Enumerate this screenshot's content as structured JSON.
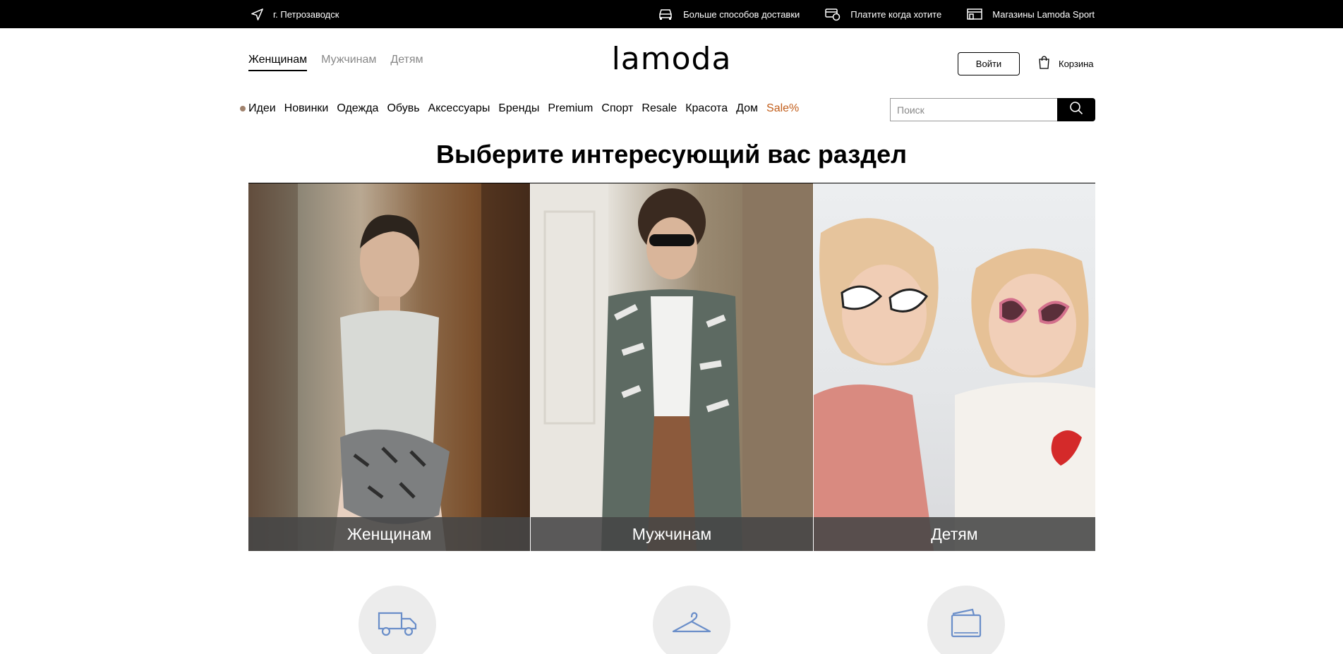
{
  "topbar": {
    "city": "г. Петрозаводск",
    "links": [
      {
        "icon": "car-icon",
        "label": "Больше способов доставки"
      },
      {
        "icon": "payment-icon",
        "label": "Платите когда хотите"
      },
      {
        "icon": "store-icon",
        "label": "Магазины Lamoda Sport"
      }
    ]
  },
  "header": {
    "gender_tabs": [
      {
        "label": "Женщинам",
        "active": true
      },
      {
        "label": "Мужчинам",
        "active": false
      },
      {
        "label": "Детям",
        "active": false
      }
    ],
    "logo": "lamoda",
    "login_label": "Войти",
    "cart_label": "Корзина"
  },
  "nav": {
    "items": [
      "Идеи",
      "Новинки",
      "Одежда",
      "Обувь",
      "Аксессуары",
      "Бренды",
      "Premium",
      "Спорт",
      "Resale",
      "Красота",
      "Дом",
      "Sale%"
    ],
    "sale_color": "#c25e1b"
  },
  "search": {
    "placeholder": "Поиск"
  },
  "main": {
    "headline": "Выберите интересующий вас раздел",
    "cards": [
      {
        "label": "Женщинам"
      },
      {
        "label": "Мужчинам"
      },
      {
        "label": "Детям"
      }
    ]
  },
  "features": [
    {
      "icon": "truck-icon"
    },
    {
      "icon": "hanger-icon"
    },
    {
      "icon": "wallet-icon"
    }
  ]
}
